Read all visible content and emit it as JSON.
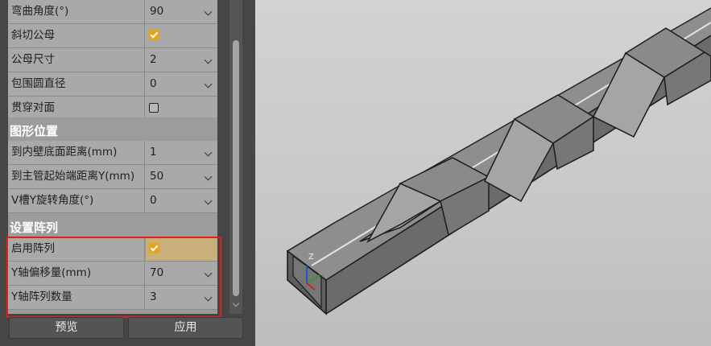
{
  "properties": {
    "rows": [
      {
        "label": "弯曲角度(°)",
        "value": "90"
      },
      {
        "label": "斜切公母",
        "checked": true
      },
      {
        "label": "公母尺寸",
        "value": "2"
      },
      {
        "label": "包围圆直径",
        "value": "0"
      },
      {
        "label": "贯穿对面",
        "checked": false
      }
    ],
    "section_position": "图形位置",
    "position_rows": [
      {
        "label": "到内壁底面距离(mm)",
        "value": "1"
      },
      {
        "label": "到主管起始端距离Y(mm)",
        "value": "50"
      },
      {
        "label": "V槽Y旋转角度(°)",
        "value": "0"
      }
    ],
    "section_array": "设置阵列",
    "array_rows": [
      {
        "label": "启用阵列",
        "checked": true
      },
      {
        "label": "Y轴偏移量(mm)",
        "value": "70"
      },
      {
        "label": "Y轴阵列数量",
        "value": "3"
      }
    ]
  },
  "buttons": {
    "preview": "预览",
    "apply": "应用"
  },
  "viewport": {
    "axis_label": "Z"
  },
  "colors": {
    "checkbox": "#e6a418",
    "highlight": "#e01e1e"
  }
}
